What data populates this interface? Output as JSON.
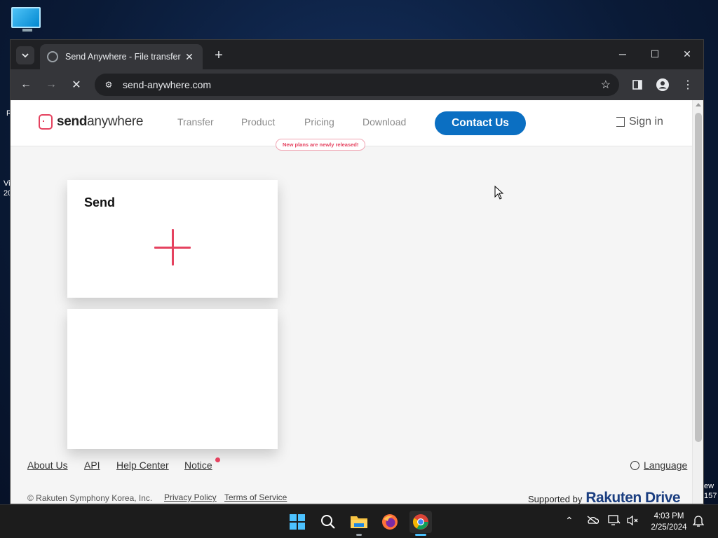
{
  "desktop": {
    "edge_left": [
      "R",
      "Vi",
      "20"
    ],
    "edge_right": [
      "ew",
      "157"
    ]
  },
  "browser": {
    "tab_title": "Send Anywhere - File transfer",
    "url": "send-anywhere.com"
  },
  "site": {
    "logo_bold": "send",
    "logo_light": "anywhere",
    "nav": [
      "Transfer",
      "Product",
      "Pricing",
      "Download"
    ],
    "badge": "New plans are newly released!",
    "contact": "Contact Us",
    "signin": "Sign in",
    "send_title": "Send",
    "footer_links": [
      "About Us",
      "API",
      "Help Center",
      "Notice"
    ],
    "language": "Language",
    "copyright": "© Rakuten Symphony Korea, Inc.",
    "privacy": "Privacy Policy",
    "terms": "Terms of Service",
    "supported_by": "Supported by",
    "brand": "Rakuten Drive"
  },
  "taskbar": {
    "time": "4:03 PM",
    "date": "2/25/2024"
  },
  "colors": {
    "accent": "#e5425f",
    "contact_bg": "#0b6fc2"
  },
  "icons": [
    "monitor-icon",
    "chevron-down-icon",
    "close-icon",
    "plus-icon",
    "minimize-icon",
    "maximize-icon",
    "back-icon",
    "forward-icon",
    "stop-icon",
    "site-info-icon",
    "star-icon",
    "sidebar-icon",
    "profile-icon",
    "menu-icon",
    "sign-in-icon",
    "globe-icon",
    "windows-icon",
    "search-icon",
    "folder-icon",
    "firefox-icon",
    "chrome-icon",
    "chevron-up-icon",
    "onedrive-icon",
    "network-icon",
    "volume-icon",
    "notification-icon"
  ]
}
